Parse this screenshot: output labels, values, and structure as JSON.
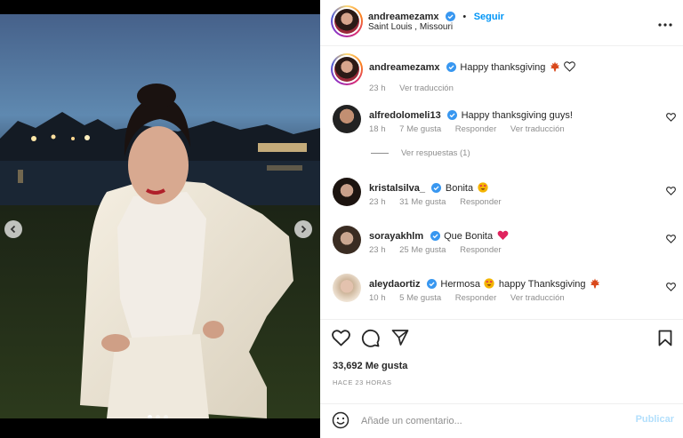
{
  "post": {
    "author": "andreamezamx",
    "follow_label": "Seguir",
    "location": "Saint Louis , Missouri",
    "more_icon": "more-horizontal-icon"
  },
  "caption": {
    "username": "andreamezamx",
    "text": "Happy thanksgiving",
    "time": "23 h",
    "see_translation": "Ver traducción"
  },
  "comments": [
    {
      "username": "alfredolomeli13",
      "text": "Happy thanksgiving guys!",
      "time": "18 h",
      "likes": "7 Me gusta",
      "reply": "Responder",
      "translate": "Ver traducción"
    },
    {
      "username": "kristalsilva_",
      "text": "Bonita",
      "time": "23 h",
      "likes": "31 Me gusta",
      "reply": "Responder"
    },
    {
      "username": "sorayakhlm",
      "text": "Que Bonita",
      "time": "23 h",
      "likes": "25 Me gusta",
      "reply": "Responder"
    },
    {
      "username": "aleydaortiz",
      "text": "Hermosa",
      "text2": "happy Thanksgiving",
      "time": "10 h",
      "likes": "5 Me gusta",
      "reply": "Responder",
      "translate": "Ver traducción"
    }
  ],
  "view_replies": "Ver respuestas (1)",
  "stats": {
    "likes": "33,692 Me gusta",
    "time_ago": "HACE 23 HORAS"
  },
  "add_comment": {
    "placeholder": "Añade un comentario...",
    "publish_label": "Publicar"
  },
  "colors": {
    "accent": "#0095f6",
    "verified": "#3897f0",
    "publish_disabled": "#b2dffc"
  },
  "carousel": {
    "slide_count": 3,
    "active_index": 0
  }
}
